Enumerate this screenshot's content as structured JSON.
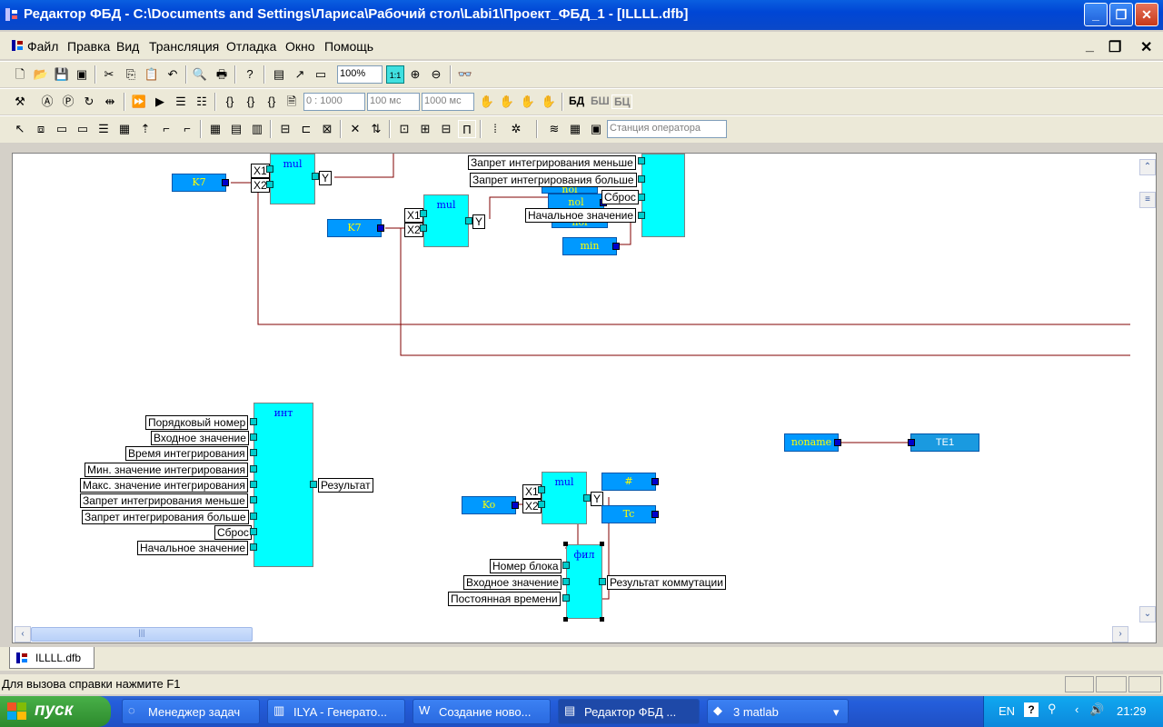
{
  "window": {
    "title": "Редактор ФБД - C:\\Documents and Settings\\Лариса\\Рабочий стол\\Labi1\\Проект_ФБД_1 - [ILLLL.dfb]"
  },
  "menu": [
    "Файл",
    "Правка",
    "Вид",
    "Трансляция",
    "Отладка",
    "Окно",
    "Помощь"
  ],
  "toolbar1": {
    "zoom": "100%",
    "fit": "1:1"
  },
  "toolbar2": {
    "range": "0 : 1000",
    "period1": "100 мс",
    "period2": "1000 мс",
    "bd": "БД",
    "bsh": "БШ",
    "bc": "БЦ"
  },
  "toolbar3": {
    "station": "Станция оператора"
  },
  "diagram": {
    "inputs": {
      "k7a": "K7",
      "k7b": "K7",
      "nol1": "nol",
      "nol2": "nol",
      "nol3": "nol",
      "min": "min",
      "ko": "Ko",
      "hash": "#",
      "tc": "Tc",
      "noname": "noname",
      "te1": "TE1"
    },
    "blocks": {
      "mul": "mul",
      "int": "инт",
      "fil": "фил"
    },
    "pins": {
      "x1": "X1",
      "x2": "X2",
      "y": "Y"
    },
    "top_labels": [
      "Запрет интегрирования меньше",
      "Запрет интегрирования больше",
      "Сброс",
      "Начальное значение"
    ],
    "int_inputs": [
      "Порядковый номер",
      "Входное значение",
      "Время интегрирования",
      "Мин. значение интегрирования",
      "Макс. значение интегрирования",
      "Запрет интегрирования меньше",
      "Запрет интегрирования больше",
      "Сброс",
      "Начальное значение"
    ],
    "int_output": "Результат",
    "fil_inputs": [
      "Номер блока",
      "Входное значение",
      "Постоянная времени"
    ],
    "fil_output": "Результат коммутации"
  },
  "tab": "ILLLL.dfb",
  "status": "Для вызова справки нажмите F1",
  "taskbar": {
    "start": "пуск",
    "tasks": [
      "Менеджер задач",
      "ILYA - Генерато...",
      "Создание ново...",
      "Редактор ФБД ...",
      "3 matlab"
    ],
    "lang": "EN",
    "time": "21:29"
  },
  "colors": {
    "block": "#00ffff",
    "input": "#0099ff",
    "wire": "#800000",
    "title": "#0046d5"
  }
}
